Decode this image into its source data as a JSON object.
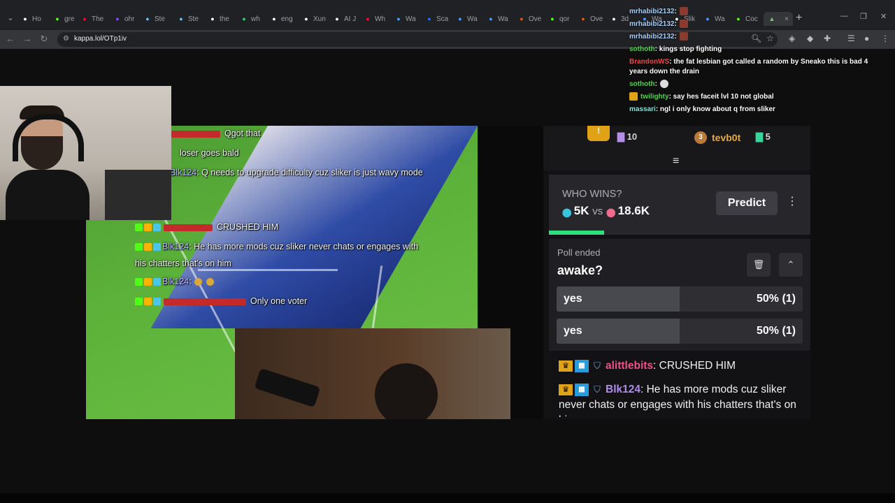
{
  "browser": {
    "tabs": [
      {
        "label": "Ho",
        "icon": "x-icon",
        "color": "#ffffff"
      },
      {
        "label": "gre",
        "icon": "kick-icon",
        "color": "#53fc18"
      },
      {
        "label": "The",
        "icon": "youtube-icon",
        "color": "#ff0033"
      },
      {
        "label": "ohr",
        "icon": "twitch-icon",
        "color": "#9146ff"
      },
      {
        "label": "Ste",
        "icon": "steam-icon",
        "color": "#66c0f4"
      },
      {
        "label": "Ste",
        "icon": "steam-icon",
        "color": "#66c0f4"
      },
      {
        "label": "the",
        "icon": "x-icon",
        "color": "#ffffff"
      },
      {
        "label": "wh",
        "icon": "whatsapp-icon",
        "color": "#25d366"
      },
      {
        "label": "eng",
        "icon": "google-icon",
        "color": "#ffffff"
      },
      {
        "label": "Xun",
        "icon": "x-icon",
        "color": "#ffffff"
      },
      {
        "label": "AI J",
        "icon": "x-icon",
        "color": "#ffffff"
      },
      {
        "label": "Wh",
        "icon": "youtube-icon",
        "color": "#ff0033"
      },
      {
        "label": "Wa",
        "icon": "wa-icon",
        "color": "#4a9eff"
      },
      {
        "label": "Sca",
        "icon": "scan-icon",
        "color": "#2d6cf5"
      },
      {
        "label": "Wa",
        "icon": "wa-icon",
        "color": "#4a9eff"
      },
      {
        "label": "Wa",
        "icon": "wa-icon",
        "color": "#4a9eff"
      },
      {
        "label": "Ove",
        "icon": "overwolf-icon",
        "color": "#e25822"
      },
      {
        "label": "qor",
        "icon": "kick-icon",
        "color": "#53fc18"
      },
      {
        "label": "Ove",
        "icon": "overwolf-icon",
        "color": "#e25822"
      },
      {
        "label": "3d",
        "icon": "tiktok-icon",
        "color": "#ffffff"
      },
      {
        "label": "Wa",
        "icon": "wa-icon",
        "color": "#4a9eff"
      },
      {
        "label": "Slik",
        "icon": "tiktok-icon",
        "color": "#ffffff"
      },
      {
        "label": "Wa",
        "icon": "wa-icon",
        "color": "#4a9eff"
      },
      {
        "label": "Coc",
        "icon": "kick-icon",
        "color": "#53fc18"
      }
    ],
    "active_tab_close": "×",
    "new_tab": "+",
    "url": "kappa.lol/OTp1iv"
  },
  "overlay_chat": [
    {
      "name": "",
      "text": "Qgot that",
      "redacted": true
    },
    {
      "name": "",
      "text": "loser goes bald",
      "redacted": false
    },
    {
      "name": "Blk124",
      "text": ": Q needs to upgrade difficulty cuz sliker is just wavy mode",
      "redacted": false
    },
    {
      "name": "",
      "text": "CRUSHED HIM",
      "redacted": true
    },
    {
      "name": "Blk124",
      "text": ": He has more mods cuz sliker never chats or engages with",
      "redacted": false
    },
    {
      "name": "",
      "text": "his chatters that's on him",
      "redacted": false
    },
    {
      "name": "Blk124",
      "text": ":",
      "redacted": false
    },
    {
      "name": "",
      "text": "Only one voter",
      "redacted": true
    }
  ],
  "leaderboard": {
    "first_count": "10",
    "third_rank": "3",
    "third_user": "tevb0t",
    "third_count": "5"
  },
  "prediction": {
    "title": "WHO WINS?",
    "left_votes": "5K",
    "vs": "vs",
    "right_votes": "18.6K",
    "button": "Predict",
    "left_share": 0.21
  },
  "poll": {
    "status": "Poll ended",
    "question": "awake?",
    "options": [
      {
        "label": "yes",
        "percent": "50% (1)",
        "share": 0.5
      },
      {
        "label": "yes",
        "percent": "50% (1)",
        "share": 0.5
      }
    ]
  },
  "chat": [
    {
      "user": "alittlebits",
      "text": ": CRUSHED HIM",
      "color": "#f0508a"
    },
    {
      "user": "Blk124",
      "text": ": He has more mods cuz sliker never chats or engages with his chatters that's on him",
      "color": "#b08cf0"
    }
  ],
  "twitch_chat": [
    {
      "user": "mrhabibi2132",
      "text": ":"
    },
    {
      "user": "mrhabibi2132",
      "text": ":"
    },
    {
      "user": "mrhabibi2132",
      "text": ":"
    },
    {
      "user": "sothoth",
      "text": ": kings stop fighting"
    },
    {
      "user": "BrandonWS",
      "text": ": the fat lesbian got called a random by Sneako this is bad 4 years down the drain"
    },
    {
      "user": "sothoth",
      "text": ":"
    },
    {
      "user": "twilighty",
      "text": ": say hes faceit lvl 10 not global"
    },
    {
      "user": "massari",
      "text": ": ngl i only know about q from sliker"
    }
  ]
}
